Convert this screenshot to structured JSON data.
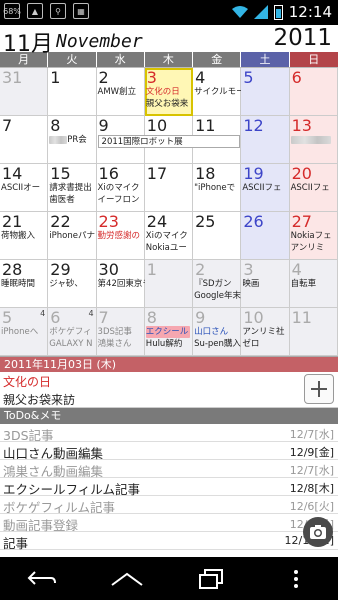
{
  "status": {
    "battery_pct": "68%",
    "time": "12:14"
  },
  "header": {
    "month_num": "11月",
    "month_name": "November",
    "year": "2011"
  },
  "weekdays": [
    "月",
    "火",
    "水",
    "木",
    "金",
    "土",
    "日"
  ],
  "weeks": [
    [
      {
        "d": "31",
        "other": true
      },
      {
        "d": "1"
      },
      {
        "d": "2",
        "ev1": "AMW創立"
      },
      {
        "d": "3",
        "ev1": "文化の日",
        "ev1c": "red",
        "ev2": "親父お袋来",
        "today": true,
        "holiday": true
      },
      {
        "d": "4",
        "ev1": "サイクルモードインターナショナ"
      },
      {
        "d": "5"
      },
      {
        "d": "6"
      }
    ],
    [
      {
        "d": "7"
      },
      {
        "d": "8",
        "ev1": "PR会",
        "blur1": true
      },
      {
        "d": "9"
      },
      {
        "d": "10"
      },
      {
        "d": "11"
      },
      {
        "d": "12"
      },
      {
        "d": "13",
        "blur1": true
      }
    ],
    [
      {
        "d": "14",
        "ev1": "ASCIIオー"
      },
      {
        "d": "15",
        "ev1": "請求書提出",
        "ev2": "歯医者"
      },
      {
        "d": "16",
        "ev1": "Xiのマイク",
        "ev2": "イーフロン"
      },
      {
        "d": "17"
      },
      {
        "d": "18",
        "ev1": "\"iPhoneで"
      },
      {
        "d": "19",
        "ev1": "ASCIIフェ"
      },
      {
        "d": "20",
        "ev1": "ASCIIフェ"
      }
    ],
    [
      {
        "d": "21",
        "ev1": "荷物搬入"
      },
      {
        "d": "22",
        "ev1": "iPhoneパナ"
      },
      {
        "d": "23",
        "ev1": "勤労感謝の",
        "ev1c": "red",
        "holiday": true
      },
      {
        "d": "24",
        "ev1": "Xiのマイク",
        "ev2": "Nokiaユー"
      },
      {
        "d": "25"
      },
      {
        "d": "26"
      },
      {
        "d": "27",
        "ev1": "Nokiaフェ",
        "ev2": "アンリミ"
      }
    ],
    [
      {
        "d": "28",
        "ev1": "睡眠時間"
      },
      {
        "d": "29",
        "ev1": "ジャ砂、"
      },
      {
        "d": "30",
        "ev1": "第42回東京モーターシ"
      },
      {
        "d": "1",
        "other": true
      },
      {
        "d": "2",
        "other": true,
        "ev1": "『SDガン",
        "ev2": "Google年末"
      },
      {
        "d": "3",
        "other": true,
        "ev1": "映画"
      },
      {
        "d": "4",
        "other": true,
        "ev1": "自転車"
      }
    ],
    [
      {
        "d": "5",
        "other": true,
        "badge": "4",
        "ev1": "iPhoneへ",
        "ev1c": "gray"
      },
      {
        "d": "6",
        "other": true,
        "badge": "4",
        "ev1": "ボケゲフィ",
        "ev1c": "gray",
        "ev2": "GALAXY N",
        "ev2c": "gray"
      },
      {
        "d": "7",
        "other": true,
        "ev1": "3DS記事",
        "ev1c": "gray",
        "ev2": "鴻巣さん",
        "ev2c": "gray"
      },
      {
        "d": "8",
        "other": true,
        "ev1": "エクシール",
        "ev1c": "blue",
        "ev2": "Hulu解約",
        "pink": true
      },
      {
        "d": "9",
        "other": true,
        "ev1": "山口さん",
        "ev1c": "blue",
        "ev2": "Su-pen購入"
      },
      {
        "d": "10",
        "other": true,
        "ev1": "アンリミ社",
        "ev2": "ゼロ"
      },
      {
        "d": "11",
        "other": true
      }
    ]
  ],
  "bars": {
    "w2_robot": "2011国際ロボット展"
  },
  "day_panel": {
    "date_label": "2011年11月03日 (木)",
    "events": [
      "文化の日",
      "親父お袋来訪"
    ]
  },
  "todo": {
    "header": "ToDo&メモ",
    "items": [
      {
        "title": "3DS記事",
        "date": "12/7[水]",
        "done": true
      },
      {
        "title": "山口さん動画編集",
        "date": "12/9[金]",
        "done": false
      },
      {
        "title": "鴻巣さん動画編集",
        "date": "12/7[水]",
        "done": true
      },
      {
        "title": "エクシールフィルム記事",
        "date": "12/8[木]",
        "done": false
      },
      {
        "title": "ボケゲフィルム記事",
        "date": "12/6[火]",
        "done": true
      },
      {
        "title": "動画記事登録",
        "date": "12/5[月]",
        "done": true
      },
      {
        "title": "記事",
        "date": "12/10[±]",
        "done": false
      }
    ]
  },
  "colors": {
    "holiday_red": "#d52b2b",
    "saturday_blue": "#3d45c8",
    "today_bg": "#fff7b5",
    "day_header": "#c46166"
  }
}
